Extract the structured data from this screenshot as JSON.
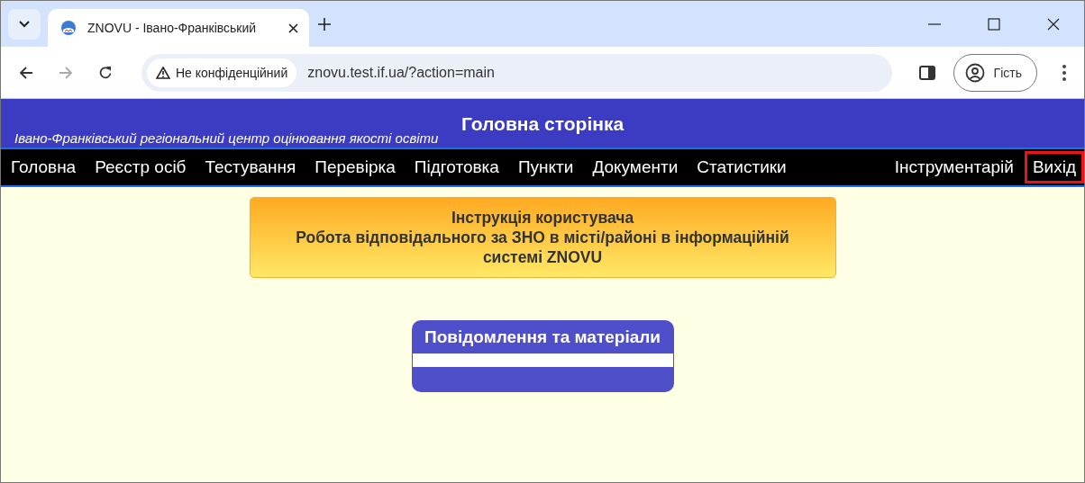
{
  "browser": {
    "tab_title": "ZNOVU - Івано-Франківський",
    "security_label": "Не конфіденційний",
    "url": "znovu.test.if.ua/?action=main",
    "profile_label": "Гість"
  },
  "header": {
    "title": "Головна сторінка",
    "subtitle": "Івано-Франківський регіональний центр оцінювання якості освіти"
  },
  "nav": {
    "left_items": [
      {
        "label": "Головна",
        "highlighted": false
      },
      {
        "label": "Реєстр осіб",
        "highlighted": false
      },
      {
        "label": "Тестування",
        "highlighted": false
      },
      {
        "label": "Перевірка",
        "highlighted": false
      },
      {
        "label": "Підготовка",
        "highlighted": false
      },
      {
        "label": "Пункти",
        "highlighted": false
      },
      {
        "label": "Документи",
        "highlighted": false
      },
      {
        "label": "Статистики",
        "highlighted": false
      }
    ],
    "right_items": [
      {
        "label": "Інструментарій",
        "highlighted": false
      },
      {
        "label": "Вихід",
        "highlighted": true
      }
    ]
  },
  "instruction_button": {
    "lines": [
      "Інструкція користувача",
      "Робота відповідального за ЗНО в місті/районі в інформаційній системі ZNOVU"
    ]
  },
  "messages_panel": {
    "title": "Повідомлення та матеріали"
  }
}
